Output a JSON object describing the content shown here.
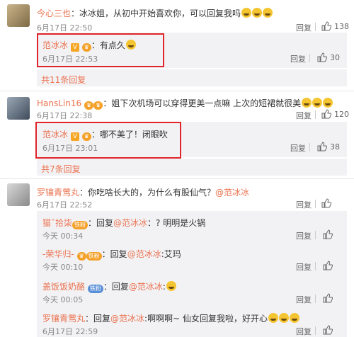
{
  "c1": {
    "name": "今心三也",
    "text": "：冰冰姐，从初中开始喜欢你，可以回复我吗",
    "time": "6月17日 22:50",
    "reply": "回复",
    "likes": "138"
  },
  "r1": {
    "name": "范冰冰",
    "text": "：有点久",
    "time": "6月17日 22:53",
    "reply": "回复",
    "likes": "30"
  },
  "more1": "共11条回复",
  "c2": {
    "name": "HansLin16",
    "text": "：姐下次机场可以穿得更美一点嘛 上次的短裙就很美",
    "time": "6月17日 22:38",
    "reply": "回复",
    "likes": "120"
  },
  "r2": {
    "name": "范冰冰",
    "text": "：哪不美了！闭眼吹",
    "time": "6月17日 23:01",
    "reply": "回复",
    "likes": "38"
  },
  "more2": "共7条回复",
  "c3": {
    "name": "罗镶青莺丸",
    "text": "：你吃啥长大的，为什么有股仙气？",
    "mention": "@范冰冰",
    "time": "6月17日 22:52",
    "reply": "回复"
  },
  "s1": {
    "name": "猫ˇ拾柒",
    "pre": "：回复",
    "mention": "@范冰冰",
    "text": "：? 明明是火锅",
    "time": "今天 00:34",
    "reply": "回复"
  },
  "s2": {
    "name": "-荣华归-",
    "pre": "：回复",
    "mention": "@范冰冰",
    "text": ":艾玛",
    "time": "今天 00:10",
    "reply": "回复"
  },
  "s3": {
    "name": "盖饭饭奶酪",
    "badge": "铁粉",
    "pre": "：回复",
    "mention": "@范冰冰",
    "text": ":",
    "time": "今天 00:05",
    "reply": "回复"
  },
  "s4": {
    "name": "罗镶青莺丸",
    "pre": "：回复",
    "mention": "@范冰冰",
    "text": ":啊啊啊~ 仙女回复我啦，好开心",
    "time": "6月17日 22:59",
    "reply": "回复"
  },
  "badges": {
    "fan": "铁粉",
    "vip": "V"
  },
  "colors": {
    "name": "#eb7350",
    "highlight_box": "#e0242a",
    "sub_bg": "#f2f2f5"
  }
}
